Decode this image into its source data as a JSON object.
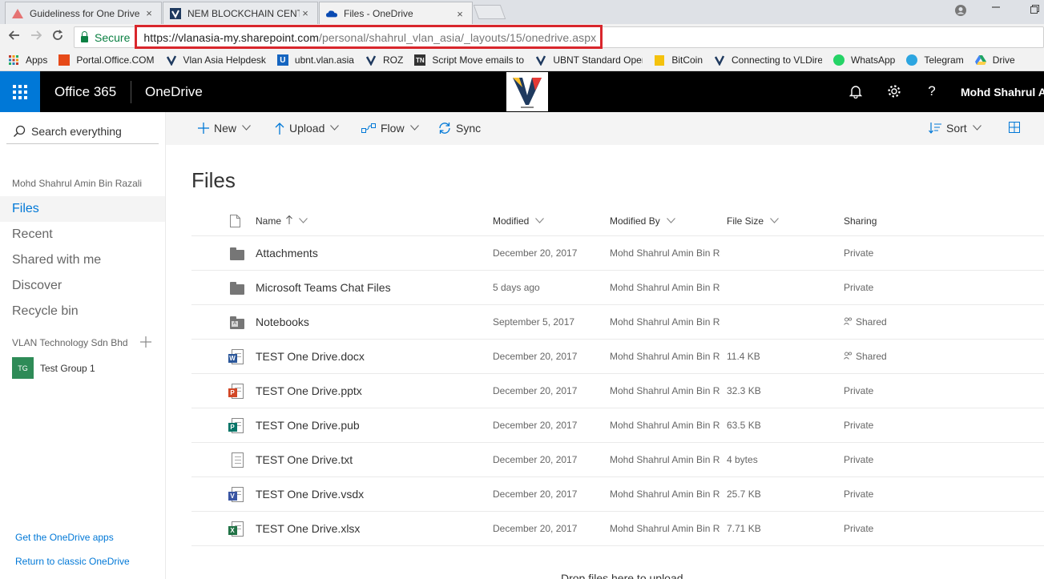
{
  "browser": {
    "tabs": [
      {
        "title": "Guideliness for One Drive",
        "favicon": "triangle-icon",
        "active": false
      },
      {
        "title": "NEM BLOCKCHAIN CENTRE",
        "favicon": "vlan-icon",
        "active": false
      },
      {
        "title": "Files - OneDrive",
        "favicon": "onedrive-cloud-icon",
        "active": true
      }
    ],
    "close_glyph": "×",
    "secure_label": "Secure",
    "url_scheme": "https://",
    "url_host": "vlanasia-my.sharepoint.com",
    "url_path": "/personal/shahrul_vlan_asia/_layouts/15/onedrive.aspx",
    "bookmarks": [
      {
        "label": "Apps",
        "icon": "apps-grid-icon",
        "color": "#c0392b"
      },
      {
        "label": "Portal.Office.COM",
        "icon": "office-icon",
        "color": "#e64a19"
      },
      {
        "label": "Vlan Asia Helpdesk",
        "icon": "vlan-icon",
        "color": "#1f3a5f"
      },
      {
        "label": "ubnt.vlan.asia",
        "icon": "ubnt-icon",
        "color": "#1565c0"
      },
      {
        "label": "ROZ",
        "icon": "vlan-icon",
        "color": "#1f3a5f"
      },
      {
        "label": "Script Move emails to",
        "icon": "tn-icon",
        "color": "#333333"
      },
      {
        "label": "UBNT Standard Oper",
        "icon": "vlan-icon",
        "color": "#1f3a5f"
      },
      {
        "label": "BitCoin",
        "icon": "folder-icon",
        "color": "#f4c20d"
      },
      {
        "label": "Connecting to VLDire",
        "icon": "vlan-icon",
        "color": "#1f3a5f"
      },
      {
        "label": "WhatsApp",
        "icon": "whatsapp-icon",
        "color": "#25d366"
      },
      {
        "label": "Telegram",
        "icon": "telegram-icon",
        "color": "#2ca5e0"
      },
      {
        "label": "Drive",
        "icon": "drive-icon",
        "color": "#1fa463"
      }
    ]
  },
  "suitebar": {
    "suite_name": "Office 365",
    "app_name": "OneDrive",
    "user_name": "Mohd Shahrul A.",
    "accent_color": "#0078d7"
  },
  "leftnav": {
    "search_placeholder": "Search everything",
    "owner": "Mohd Shahrul Amin Bin Razali",
    "items": [
      "Files",
      "Recent",
      "Shared with me",
      "Discover",
      "Recycle bin"
    ],
    "group_section": "VLAN Technology Sdn Bhd",
    "groups": [
      {
        "initials": "TG",
        "name": "Test Group 1"
      }
    ],
    "links": [
      "Get the OneDrive apps",
      "Return to classic OneDrive"
    ]
  },
  "commands": {
    "new": "New",
    "upload": "Upload",
    "flow": "Flow",
    "sync": "Sync",
    "sort": "Sort"
  },
  "main": {
    "title": "Files",
    "columns": {
      "name": "Name",
      "modified": "Modified",
      "modified_by": "Modified By",
      "file_size": "File Size",
      "sharing": "Sharing"
    },
    "files": [
      {
        "name": "Attachments",
        "type": "folder",
        "modified": "December 20, 2017",
        "modified_by": "Mohd Shahrul Amin Bin Razali",
        "size": "",
        "sharing": "Private"
      },
      {
        "name": "Microsoft Teams Chat Files",
        "type": "folder",
        "modified": "5 days ago",
        "modified_by": "Mohd Shahrul Amin Bin Razali",
        "size": "",
        "sharing": "Private"
      },
      {
        "name": "Notebooks",
        "type": "notebook-folder",
        "modified": "September 5, 2017",
        "modified_by": "Mohd Shahrul Amin Bin Razali",
        "size": "",
        "sharing": "Shared"
      },
      {
        "name": "TEST One Drive.docx",
        "type": "word",
        "modified": "December 20, 2017",
        "modified_by": "Mohd Shahrul Amin Bin Razali",
        "size": "11.4 KB",
        "sharing": "Shared"
      },
      {
        "name": "TEST One Drive.pptx",
        "type": "powerpoint",
        "modified": "December 20, 2017",
        "modified_by": "Mohd Shahrul Amin Bin Razali",
        "size": "32.3 KB",
        "sharing": "Private"
      },
      {
        "name": "TEST One Drive.pub",
        "type": "publisher",
        "modified": "December 20, 2017",
        "modified_by": "Mohd Shahrul Amin Bin Razali",
        "size": "63.5 KB",
        "sharing": "Private"
      },
      {
        "name": "TEST One Drive.txt",
        "type": "text",
        "modified": "December 20, 2017",
        "modified_by": "Mohd Shahrul Amin Bin Razali",
        "size": "4 bytes",
        "sharing": "Private"
      },
      {
        "name": "TEST One Drive.vsdx",
        "type": "visio",
        "modified": "December 20, 2017",
        "modified_by": "Mohd Shahrul Amin Bin Razali",
        "size": "25.7 KB",
        "sharing": "Private"
      },
      {
        "name": "TEST One Drive.xlsx",
        "type": "excel",
        "modified": "December 20, 2017",
        "modified_by": "Mohd Shahrul Amin Bin Razali",
        "size": "7.71 KB",
        "sharing": "Private"
      }
    ],
    "drop_hint": "Drop files here to upload"
  }
}
